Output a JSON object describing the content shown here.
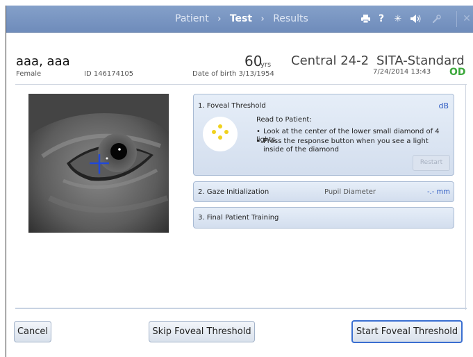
{
  "topbar": {
    "breadcrumb": [
      "Patient",
      "Test",
      "Results"
    ],
    "separator": "›",
    "icons": [
      {
        "name": "printer-icon",
        "glyph": "🖨"
      },
      {
        "name": "help-icon",
        "glyph": "?"
      },
      {
        "name": "brightness-icon",
        "glyph": "✳"
      },
      {
        "name": "speaker-icon",
        "glyph": "◀"
      },
      {
        "name": "wrench-icon",
        "glyph": "🔧"
      },
      {
        "name": "close-icon",
        "glyph": "✕"
      }
    ]
  },
  "patient": {
    "name": "aaa, aaa",
    "sex": "Female",
    "id": "ID 146174105",
    "age": "60",
    "age_unit": "yrs",
    "dob": "Date of birth  3/13/1954"
  },
  "test": {
    "name": "Central 24-2",
    "strategy": "SITA-Standard",
    "datetime": "7/24/2014 13:43",
    "eye": "OD"
  },
  "panels": {
    "foveal": {
      "title": "1. Foveal Threshold",
      "unit": "dB",
      "read_label": "Read to Patient:",
      "instructions": [
        "Look at the center of the lower small diamond of 4 lights",
        "Press the response button when you see a light inside of the diamond"
      ],
      "restart_label": "Restart"
    },
    "gaze": {
      "title": "2. Gaze Initialization",
      "pupil_label": "Pupil Diameter",
      "pupil_value": "-.- mm"
    },
    "training": {
      "title": "3. Final Patient Training"
    }
  },
  "buttons": {
    "cancel": "Cancel",
    "skip": "Skip Foveal Threshold",
    "start": "Start Foveal Threshold"
  },
  "colors": {
    "accent": "#2e5bc2",
    "eye_label": "#3ca83c",
    "stimulus": "#f0d21e",
    "topbar": "#7b97c4"
  }
}
